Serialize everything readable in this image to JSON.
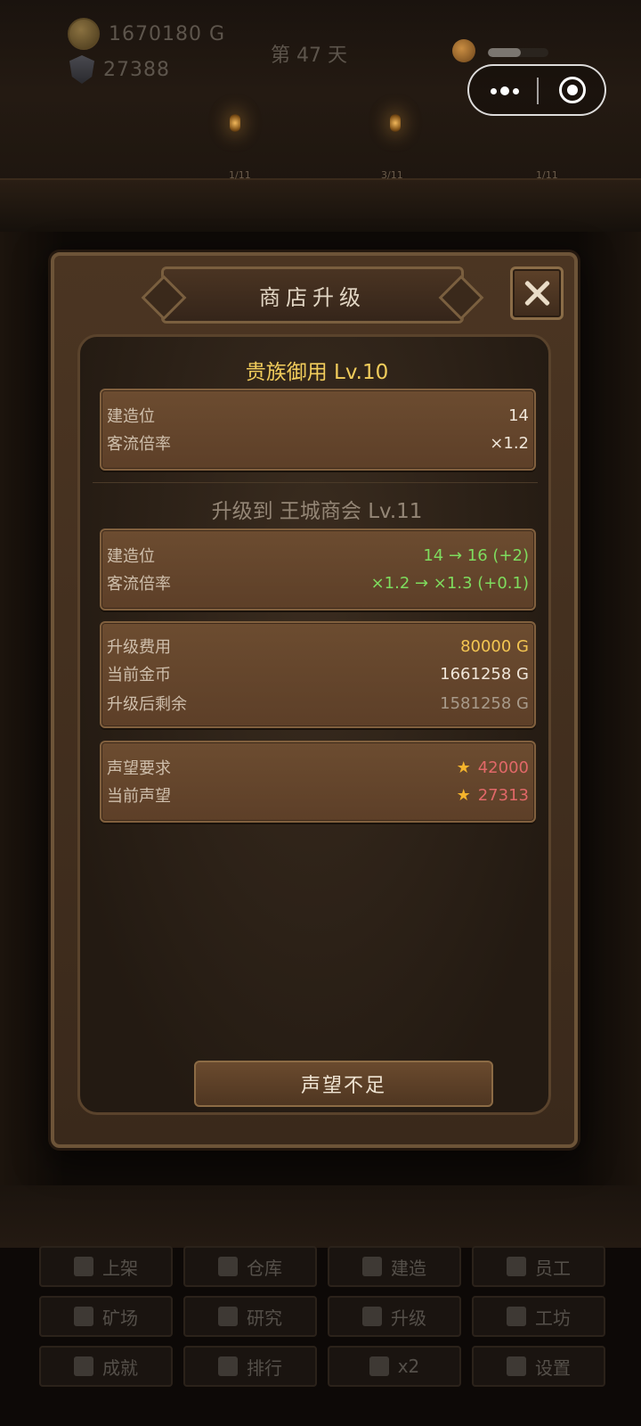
{
  "hud": {
    "gold": "1670180 G",
    "reputation": "27388",
    "day": "第 47 天",
    "energy_fraction": 0.55
  },
  "shelf_slots": [
    "1/11",
    "3/11",
    "1/11"
  ],
  "modal": {
    "title": "商店升级",
    "current_level": "贵族御用  Lv.10",
    "current_stats": [
      {
        "label": "建造位",
        "value": "14"
      },
      {
        "label": "客流倍率",
        "value": "×1.2"
      }
    ],
    "upgrade_heading": "升级到  王城商会  Lv.11",
    "next_stats": [
      {
        "label": "建造位",
        "value": "14 → 16  (+2)"
      },
      {
        "label": "客流倍率",
        "value": "×1.2 → ×1.3  (+0.1)"
      }
    ],
    "cost": [
      {
        "label": "升级费用",
        "value": "80000 G"
      },
      {
        "label": "当前金币",
        "value": "1661258 G"
      },
      {
        "label": "升级后剩余",
        "value": "1581258 G"
      }
    ],
    "reputation": [
      {
        "label": "声望要求",
        "value": "42000"
      },
      {
        "label": "当前声望",
        "value": "27313"
      }
    ],
    "action_label": "声望不足"
  },
  "menu": [
    {
      "label": "上架",
      "icon": "hammer-icon"
    },
    {
      "label": "仓库",
      "icon": "box-icon"
    },
    {
      "label": "建造",
      "icon": "building-icon"
    },
    {
      "label": "员工",
      "icon": "person-icon"
    },
    {
      "label": "矿场",
      "icon": "pickaxe-icon"
    },
    {
      "label": "研究",
      "icon": "book-icon"
    },
    {
      "label": "升级",
      "icon": "chevrons-up-icon"
    },
    {
      "label": "工坊",
      "icon": "cart-icon"
    },
    {
      "label": "成就",
      "icon": "trophy-icon"
    },
    {
      "label": "排行",
      "icon": "podium-icon"
    },
    {
      "label": "x2",
      "icon": "lightning-icon"
    },
    {
      "label": "设置",
      "icon": "fast-forward-icon"
    }
  ],
  "colors": {
    "gold_text": "#f2cd5c",
    "green_text": "#7edc5e",
    "red_text": "#e16868",
    "star": "#f5b42c"
  }
}
